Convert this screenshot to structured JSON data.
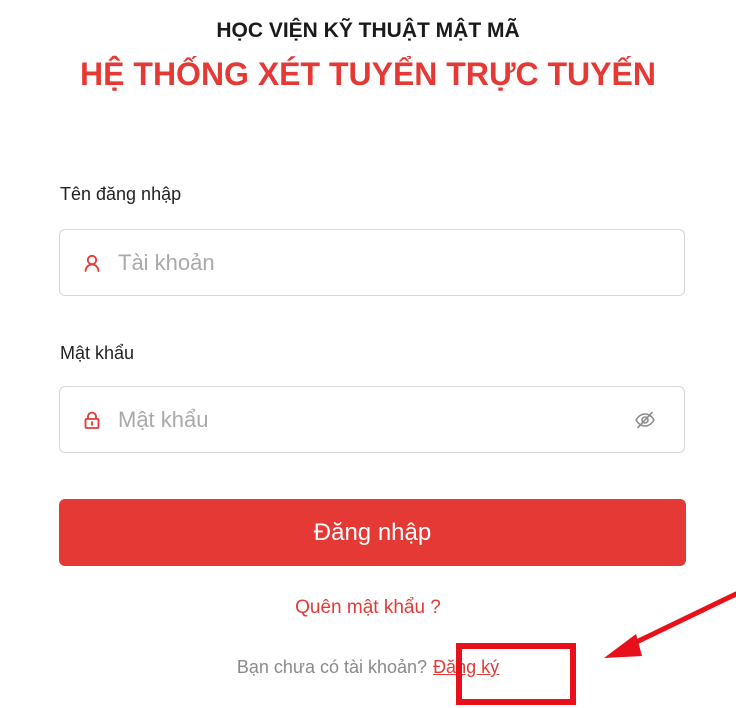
{
  "header": {
    "institution": "HỌC VIỆN KỸ THUẬT MẬT MÃ",
    "system_title": "HỆ THỐNG XÉT TUYỂN TRỰC TUYẾN"
  },
  "form": {
    "username": {
      "label": "Tên đăng nhập",
      "placeholder": "Tài khoản",
      "value": "",
      "icon": "user-icon"
    },
    "password": {
      "label": "Mật khẩu",
      "placeholder": "Mật khẩu",
      "value": "",
      "icon": "lock-icon",
      "toggle_icon": "eye-hidden-icon"
    },
    "login_label": "Đăng nhập",
    "forgot_label": "Quên mật khẩu ?",
    "register_prompt": "Bạn chưa có tài khoản?",
    "register_label": "Đăng ký"
  },
  "colors": {
    "accent": "#e53935",
    "annotation": "#e8101a"
  }
}
